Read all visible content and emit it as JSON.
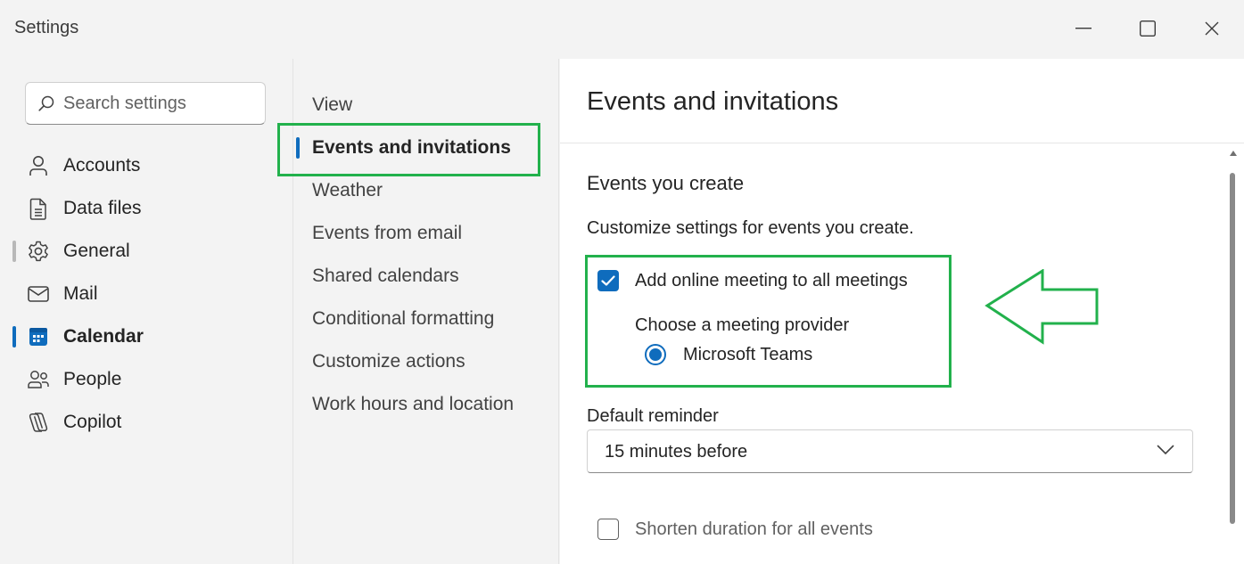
{
  "window": {
    "title": "Settings"
  },
  "search": {
    "placeholder": "Search settings"
  },
  "nav": {
    "items": [
      {
        "label": "Accounts",
        "icon": "person-icon"
      },
      {
        "label": "Data files",
        "icon": "document-icon"
      },
      {
        "label": "General",
        "icon": "gear-icon"
      },
      {
        "label": "Mail",
        "icon": "mail-icon"
      },
      {
        "label": "Calendar",
        "icon": "calendar-icon"
      },
      {
        "label": "People",
        "icon": "people-icon"
      },
      {
        "label": "Copilot",
        "icon": "copilot-icon"
      }
    ],
    "active": "Calendar"
  },
  "subnav": {
    "items": [
      {
        "label": "View"
      },
      {
        "label": "Events and invitations"
      },
      {
        "label": "Weather"
      },
      {
        "label": "Events from email"
      },
      {
        "label": "Shared calendars"
      },
      {
        "label": "Conditional formatting"
      },
      {
        "label": "Customize actions"
      },
      {
        "label": "Work hours and location"
      }
    ],
    "active": "Events and invitations"
  },
  "content": {
    "title": "Events and invitations",
    "section_title": "Events you create",
    "section_desc": "Customize settings for events you create.",
    "online_meeting": {
      "label": "Add online meeting to all meetings",
      "checked": true
    },
    "provider": {
      "label": "Choose a meeting provider",
      "option": "Microsoft Teams",
      "selected": true
    },
    "reminder": {
      "label": "Default reminder",
      "value": "15 minutes before"
    },
    "shorten": {
      "label": "Shorten duration for all events",
      "checked": false
    }
  },
  "colors": {
    "accent": "#0f6cbd",
    "highlight": "#22b14c",
    "background": "#f3f3f3"
  }
}
